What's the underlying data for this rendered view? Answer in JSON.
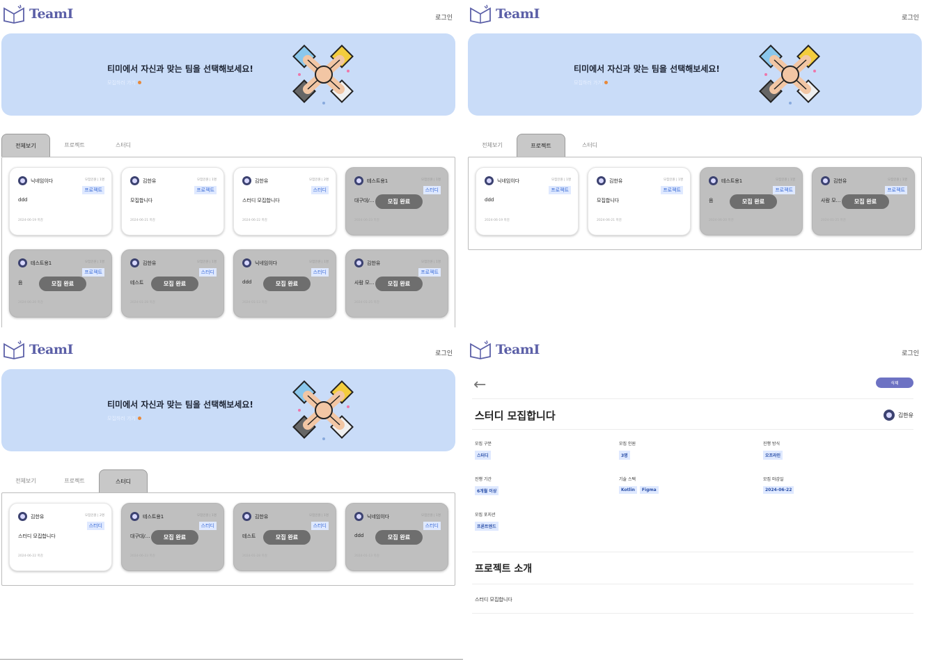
{
  "app": {
    "name": "TeamI",
    "login_label": "로그인"
  },
  "banner": {
    "title": "티미에서 자신과 맞는 팀을 선택해보세요!",
    "subtitle": "모집하러 가기"
  },
  "tabs": [
    "전체보기",
    "프로젝트",
    "스터디"
  ],
  "closed_label": "모집 완료",
  "panel1": {
    "active_tab": 0,
    "cards": [
      {
        "author": "닉네임이다",
        "meta": "모집인원 | 1명",
        "badge": "프로젝트",
        "title": "ddd",
        "date": "2024-06-19 마감",
        "closed": false
      },
      {
        "author": "김한유",
        "meta": "모집인원 | 1명",
        "badge": "프로젝트",
        "title": "모집합니다",
        "date": "2024-06-21 마감",
        "closed": false
      },
      {
        "author": "김한유",
        "meta": "모집인원 | 2명",
        "badge": "스터디",
        "title": "스터디 모집합니다",
        "date": "2024-06-22 마감",
        "closed": false
      },
      {
        "author": "테스트용1",
        "meta": "모집인원 | 1명",
        "badge": "스터디",
        "title": "대구대/…",
        "date": "2024-06-23 마감",
        "closed": true
      },
      {
        "author": "테스트용1",
        "meta": "모집인원 | 1명",
        "badge": "프로젝트",
        "title": "음",
        "date": "2024-06-20 마감",
        "closed": true
      },
      {
        "author": "김한유",
        "meta": "모집인원 | 1명",
        "badge": "스터디",
        "title": "테스트",
        "date": "2024-01-28 마감",
        "closed": true
      },
      {
        "author": "닉네임이다",
        "meta": "모집인원 | 1명",
        "badge": "스터디",
        "title": "ddd",
        "date": "2024-01-13 마감",
        "closed": true
      },
      {
        "author": "김한유",
        "meta": "모집인원 | 1명",
        "badge": "프로젝트",
        "title": "사람 모…",
        "date": "2024-01-25 마감",
        "closed": true
      }
    ]
  },
  "panel2": {
    "active_tab": 1,
    "cards": [
      {
        "author": "닉네임이다",
        "meta": "모집인원 | 1명",
        "badge": "프로젝트",
        "title": "ddd",
        "date": "2024-06-19 마감",
        "closed": false
      },
      {
        "author": "김한유",
        "meta": "모집인원 | 1명",
        "badge": "프로젝트",
        "title": "모집합니다",
        "date": "2024-06-21 마감",
        "closed": false
      },
      {
        "author": "테스트용1",
        "meta": "모집인원 | 1명",
        "badge": "프로젝트",
        "title": "음",
        "date": "2024-06-20 마감",
        "closed": true
      },
      {
        "author": "김한유",
        "meta": "모집인원 | 1명",
        "badge": "프로젝트",
        "title": "사람 모…",
        "date": "2024-01-25 마감",
        "closed": true
      }
    ]
  },
  "panel3": {
    "active_tab": 2,
    "cards": [
      {
        "author": "김한유",
        "meta": "모집인원 | 2명",
        "badge": "스터디",
        "title": "스터디 모집합니다",
        "date": "2024-06-22 마감",
        "closed": false
      },
      {
        "author": "테스트용1",
        "meta": "모집인원 | 1명",
        "badge": "스터디",
        "title": "대구대/…",
        "date": "2024-06-23 마감",
        "closed": true
      },
      {
        "author": "김한유",
        "meta": "모집인원 | 1명",
        "badge": "스터디",
        "title": "테스트",
        "date": "2024-01-28 마감",
        "closed": true
      },
      {
        "author": "닉네임이다",
        "meta": "모집인원 | 1명",
        "badge": "스터디",
        "title": "ddd",
        "date": "2024-01-13 마감",
        "closed": true
      }
    ]
  },
  "detail": {
    "delete_label": "삭제",
    "title": "스터디 모집합니다",
    "author": "김한유",
    "fields": [
      {
        "label": "모집 구분",
        "values": [
          "스터디"
        ]
      },
      {
        "label": "모집 인원",
        "values": [
          "3명"
        ]
      },
      {
        "label": "진행 방식",
        "values": [
          "오프라인"
        ]
      },
      {
        "label": "진행 기간",
        "values": [
          "6개월 이상"
        ]
      },
      {
        "label": "기술 스택",
        "values": [
          "Kotlin",
          "Figma"
        ]
      },
      {
        "label": "모집 마감일",
        "values": [
          "2024-06-22"
        ]
      },
      {
        "label": "모집 포지션",
        "values": [
          "프론트엔드"
        ]
      }
    ],
    "section_title": "프로젝트 소개",
    "section_body": "스터디 모집합니다"
  }
}
